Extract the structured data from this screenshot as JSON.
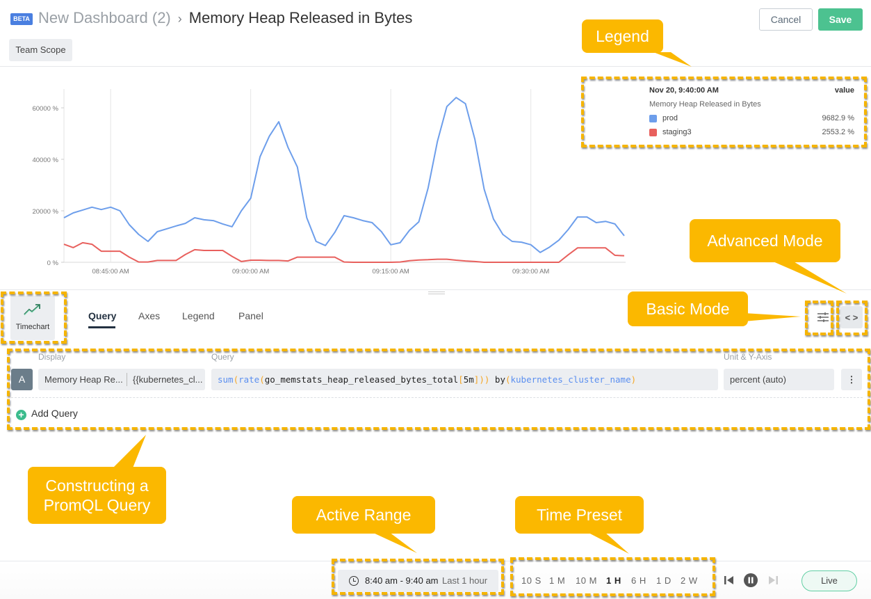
{
  "header": {
    "beta_badge": "BETA",
    "breadcrumb_parent": "New Dashboard (2)",
    "breadcrumb_separator": "›",
    "breadcrumb_current": "Memory Heap Released in Bytes",
    "scope_button": "Team Scope",
    "cancel_label": "Cancel",
    "save_label": "Save"
  },
  "colors": {
    "prod": "#6d9eeb",
    "staging3": "#e8605d",
    "accent_green": "#4cc290",
    "annotation": "#fbb800"
  },
  "legend": {
    "timestamp": "Nov 20, 9:40:00 AM",
    "value_header": "value",
    "metric_title": "Memory Heap Released in Bytes",
    "entries": [
      {
        "name": "prod",
        "value": "9682.9 %",
        "color": "#6d9eeb"
      },
      {
        "name": "staging3",
        "value": "2553.2 %",
        "color": "#e8605d"
      }
    ]
  },
  "chart_data": {
    "type": "line",
    "title": "Memory Heap Released in Bytes",
    "xlabel": "",
    "ylabel": "",
    "x_start": "08:40",
    "x_step_minutes": 1,
    "x_ticks": [
      "08:45:00 AM",
      "09:00:00 AM",
      "09:15:00 AM",
      "09:30:00 AM"
    ],
    "x_tick_minutes": [
      5,
      20,
      35,
      50
    ],
    "y_ticks": [
      "0 %",
      "20000 %",
      "40000 %",
      "60000 %"
    ],
    "y_tick_values": [
      0,
      20000,
      40000,
      60000
    ],
    "ylim": [
      0,
      66000
    ],
    "grid": "vertical",
    "series": [
      {
        "name": "prod",
        "color": "#6d9eeb",
        "values": [
          17300,
          19200,
          20300,
          21400,
          20500,
          21400,
          20000,
          14600,
          10800,
          8100,
          11900,
          13000,
          14100,
          15100,
          17300,
          16500,
          16200,
          14900,
          13800,
          20000,
          24900,
          41000,
          49000,
          54600,
          44600,
          37000,
          17300,
          8100,
          6500,
          11600,
          18100,
          17300,
          16200,
          15400,
          11900,
          6800,
          7600,
          12400,
          15700,
          28900,
          47000,
          60500,
          64000,
          61600,
          47800,
          28400,
          16800,
          10800,
          8100,
          7800,
          6800,
          3800,
          5900,
          8600,
          12700,
          17600,
          17600,
          15400,
          15900,
          14900,
          10300
        ]
      },
      {
        "name": "staging3",
        "color": "#e8605d",
        "values": [
          7000,
          5700,
          7600,
          7000,
          4300,
          4300,
          4300,
          2000,
          100,
          100,
          700,
          700,
          700,
          3000,
          4900,
          4600,
          4600,
          4600,
          2300,
          300,
          800,
          800,
          700,
          700,
          500,
          2000,
          2000,
          2000,
          2000,
          2000,
          100,
          0,
          0,
          0,
          0,
          0,
          100,
          600,
          900,
          1000,
          1200,
          1200,
          800,
          500,
          300,
          0,
          0,
          0,
          0,
          0,
          0,
          0,
          0,
          0,
          2900,
          5600,
          5600,
          5600,
          5600,
          2700,
          2553
        ]
      }
    ]
  },
  "editor": {
    "viz_type": "Timechart",
    "tabs": [
      "Query",
      "Axes",
      "Legend",
      "Panel"
    ],
    "active_tab": "Query",
    "col_display": "Display",
    "col_query": "Query",
    "col_unit": "Unit & Y-Axis",
    "query_letter": "A",
    "display_name": "Memory Heap Re...",
    "display_legend": "{{kubernetes_cl...",
    "query_parts": {
      "fn1": "sum",
      "fn2": "rate",
      "metric": "go_memstats_heap_released_bytes_total",
      "range": "5m",
      "by": " by",
      "label": "kubernetes_cluster_name"
    },
    "unit": "percent (auto)",
    "more_icon": "⋮",
    "add_query": "Add Query"
  },
  "footer": {
    "range_time": "8:40 am - 9:40 am",
    "range_label": "Last 1 hour",
    "presets": [
      "10 S",
      "1 M",
      "10 M",
      "1 H",
      "6 H",
      "1 D",
      "2 W"
    ],
    "active_preset": "1 H",
    "live_label": "Live"
  },
  "annotations": {
    "legend": "Legend",
    "advanced_mode": "Advanced Mode",
    "basic_mode": "Basic Mode",
    "promql_line1": "Constructing a",
    "promql_line2": "PromQL Query",
    "active_range": "Active Range",
    "time_preset": "Time Preset"
  }
}
